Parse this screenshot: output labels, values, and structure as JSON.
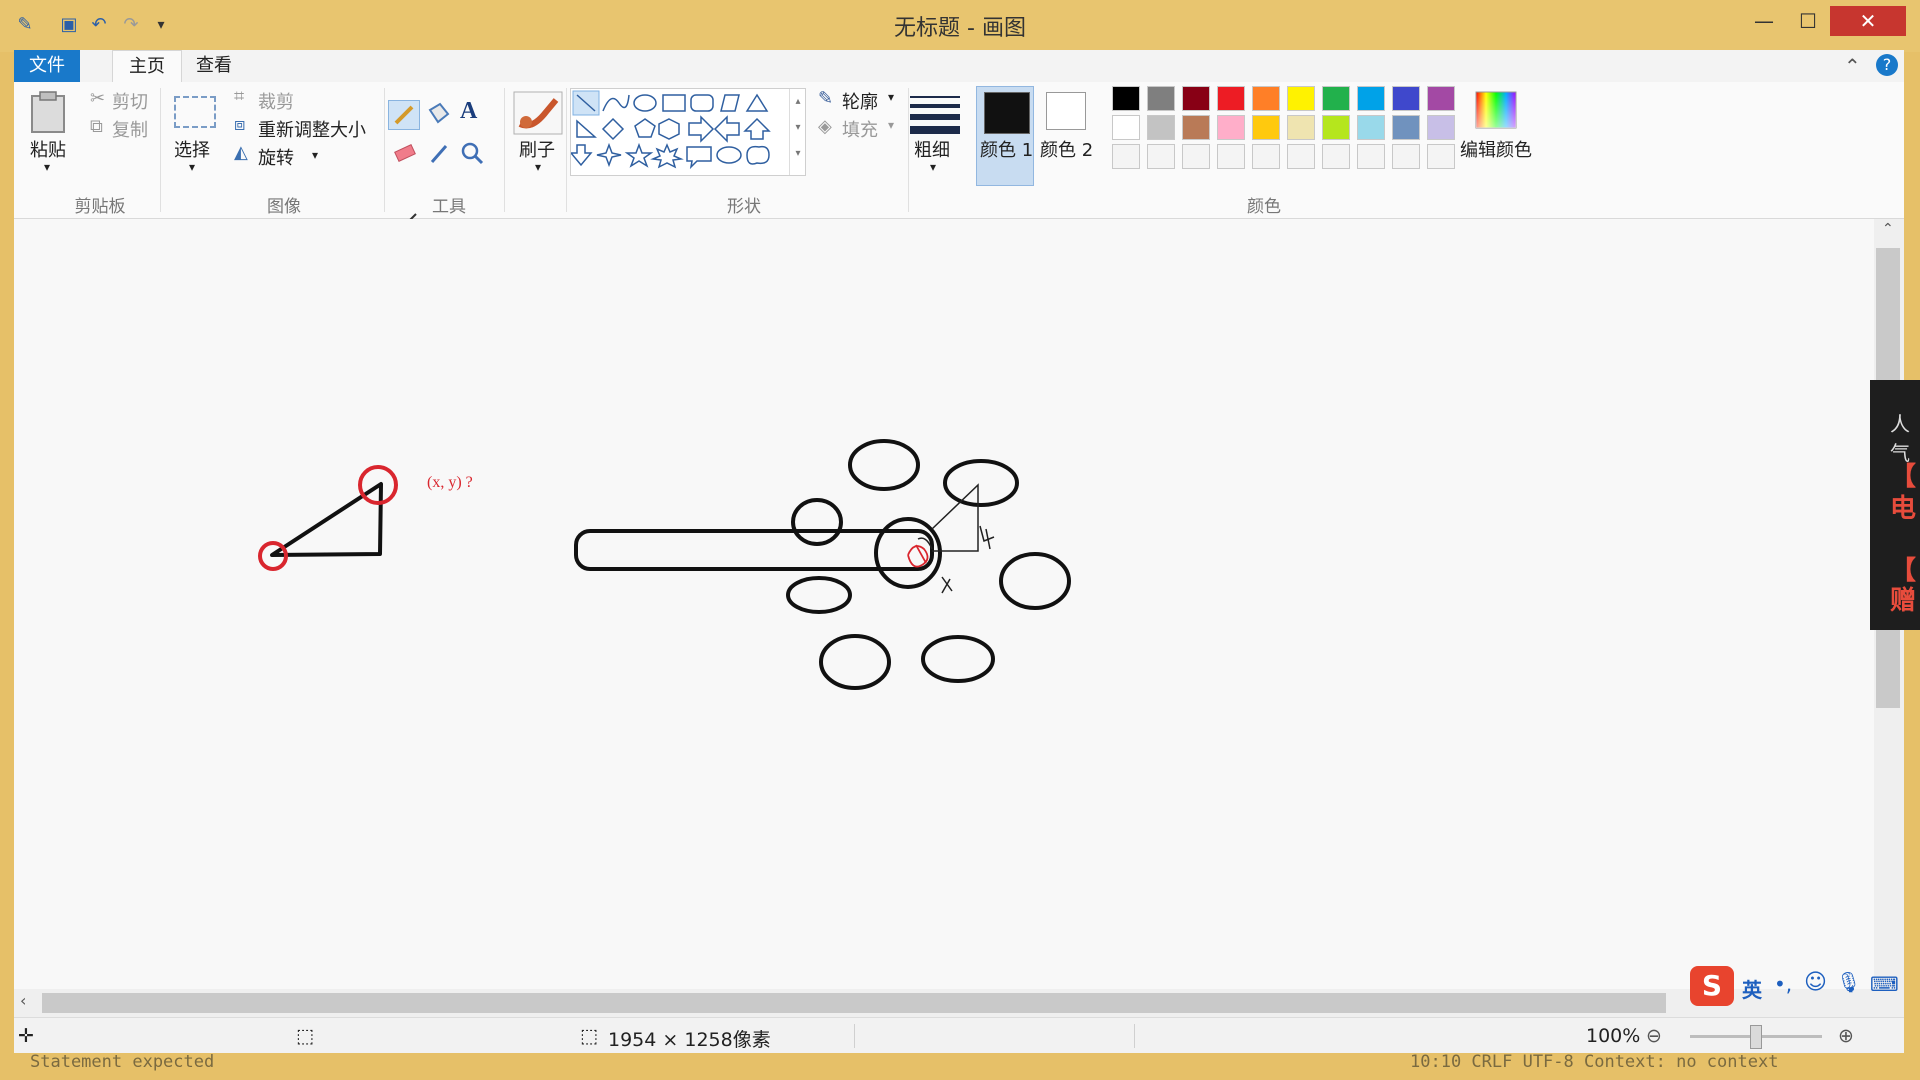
{
  "window": {
    "title": "无标题 - 画图"
  },
  "tabs": {
    "file": "文件",
    "home": "主页",
    "view": "查看"
  },
  "clipboard": {
    "paste": "粘贴",
    "cut": "剪切",
    "copy": "复制",
    "group": "剪贴板"
  },
  "image": {
    "select": "选择",
    "crop": "裁剪",
    "resize": "重新调整大小",
    "rotate": "旋转",
    "group": "图像"
  },
  "tools": {
    "group": "工具"
  },
  "brushes": {
    "label": "刷子"
  },
  "shapes": {
    "group": "形状",
    "outline": "轮廓",
    "fill": "填充"
  },
  "size": {
    "label": "粗细"
  },
  "colors": {
    "color1": "颜色 1",
    "color2": "颜色 2",
    "group": "颜色",
    "edit": "编辑颜色",
    "row1": [
      "#000000",
      "#7f7f7f",
      "#880015",
      "#ed1c24",
      "#ff7f27",
      "#fff200",
      "#22b14c",
      "#00a2e8",
      "#3f48cc",
      "#a349a4"
    ],
    "row2": [
      "#ffffff",
      "#c3c3c3",
      "#b97a57",
      "#ffaec9",
      "#ffc90e",
      "#efe4b0",
      "#b5e61d",
      "#99d9ea",
      "#7092be",
      "#c8bfe7"
    ],
    "color1_value": "#111111",
    "color2_value": "#ffffff"
  },
  "canvas": {
    "annotation": "(x, y) ?"
  },
  "status": {
    "dimensions": "1954 × 1258像素",
    "zoom": "100%"
  },
  "overlay": {
    "panel_text": [
      "人气",
      "【",
      "电",
      "【",
      "赠"
    ],
    "ime_label": "英"
  },
  "background_text": {
    "left": "Statement expected",
    "right": "10:10  CRLF  UTF-8  Context: no context"
  }
}
